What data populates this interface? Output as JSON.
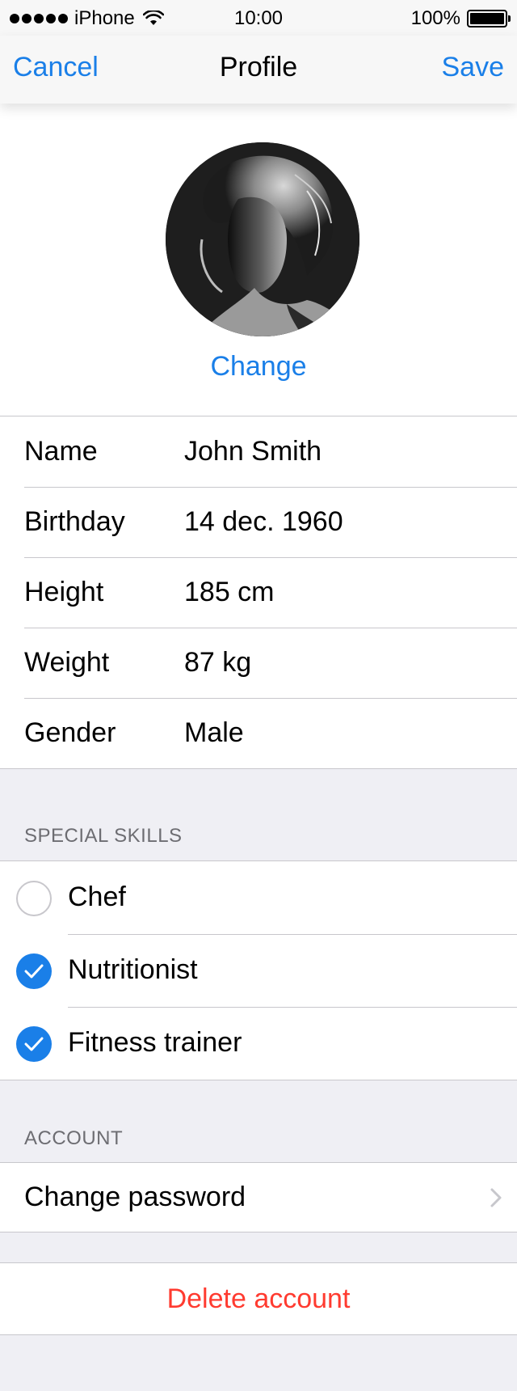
{
  "status_bar": {
    "carrier": "iPhone",
    "time": "10:00",
    "battery": "100%"
  },
  "nav": {
    "cancel_label": "Cancel",
    "title": "Profile",
    "save_label": "Save"
  },
  "avatar": {
    "change_label": "Change"
  },
  "fields": [
    {
      "label": "Name",
      "value": "John Smith"
    },
    {
      "label": "Birthday",
      "value": "14 dec. 1960"
    },
    {
      "label": "Height",
      "value": "185 cm"
    },
    {
      "label": "Weight",
      "value": "87 kg"
    },
    {
      "label": "Gender",
      "value": "Male"
    }
  ],
  "skills": {
    "header": "SPECIAL SKILLS",
    "items": [
      {
        "label": "Chef",
        "checked": false
      },
      {
        "label": "Nutritionist",
        "checked": true
      },
      {
        "label": "Fitness trainer",
        "checked": true
      }
    ]
  },
  "account": {
    "header": "ACCOUNT",
    "change_password_label": "Change password",
    "delete_label": "Delete account"
  },
  "colors": {
    "accent": "#1a7fe8",
    "destructive": "#ff3b30",
    "grouped_background": "#efeff4",
    "separator": "#c8c7cc"
  },
  "icons": {
    "signal": "signal-dots-icon",
    "wifi": "wifi-icon",
    "battery": "battery-icon",
    "check": "checkmark-icon",
    "chevron": "chevron-right-icon"
  }
}
